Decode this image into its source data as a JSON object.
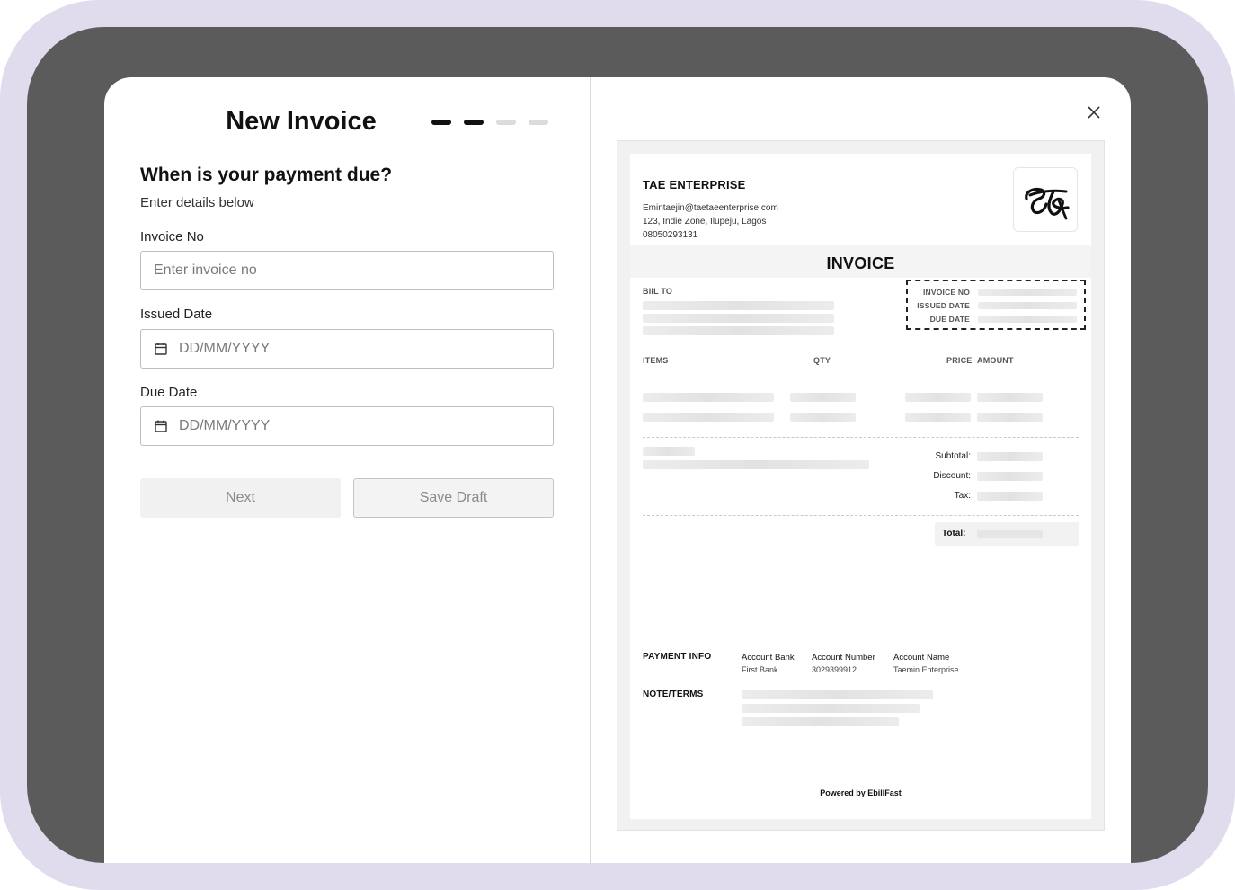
{
  "form": {
    "title": "New Invoice",
    "steps": [
      {
        "label": "step-1",
        "active": true
      },
      {
        "label": "step-2",
        "active": true
      },
      {
        "label": "step-3",
        "active": false
      },
      {
        "label": "step-4",
        "active": false
      }
    ],
    "question": "When is your payment due?",
    "subtitle": "Enter details below",
    "invoice_no": {
      "label": "Invoice No",
      "placeholder": "Enter invoice no"
    },
    "issued_date": {
      "label": "Issued Date",
      "placeholder": "DD/MM/YYYY"
    },
    "due_date": {
      "label": "Due Date",
      "placeholder": "DD/MM/YYYY"
    },
    "next_label": "Next",
    "save_draft_label": "Save Draft"
  },
  "preview": {
    "company_name": "TAE ENTERPRISE",
    "company_email": "Emintaejin@taetaeenterprise.com",
    "company_address": "123, Indie Zone, Ilupeju, Lagos",
    "company_phone": "08050293131",
    "logo_text": "TA",
    "invoice_title": "INVOICE",
    "bill_to_label": "BIIL TO",
    "meta_labels": {
      "invoice_no": "INVOICE NO",
      "issued_date": "ISSUED DATE",
      "due_date": "DUE DATE"
    },
    "columns": {
      "items": "ITEMS",
      "qty": "QTY",
      "price": "PRICE",
      "amount": "AMOUNT"
    },
    "summary": {
      "subtotal": "Subtotal:",
      "discount": "Discount:",
      "tax": "Tax:",
      "total": "Total:"
    },
    "payment": {
      "heading": "PAYMENT INFO",
      "bank_label": "Account Bank",
      "bank_value": "First Bank",
      "number_label": "Account Number",
      "number_value": "3029399912",
      "name_label": "Account Name",
      "name_value": "Taemin Enterprise"
    },
    "notes_label": "NOTE/TERMS",
    "powered_by": "Powered by EbillFast"
  },
  "colors": {
    "frame_outer": "#e0dcee",
    "frame_inner": "#5b5b5b",
    "accent": "#111111",
    "muted": "#8a8a8a"
  },
  "icons": {
    "calendar": "calendar-icon",
    "close": "close-icon"
  }
}
